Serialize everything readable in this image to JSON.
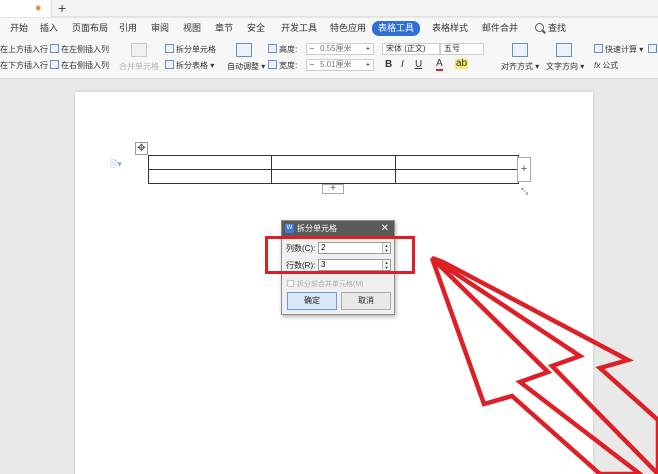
{
  "tabbar": {
    "new_tab": "+"
  },
  "menu": {
    "items": [
      "开始",
      "插入",
      "页面布局",
      "引用",
      "审阅",
      "视图",
      "章节",
      "安全",
      "开发工具",
      "特色应用",
      "表格工具",
      "表格样式",
      "邮件合并"
    ],
    "active": "表格工具",
    "search": "查找"
  },
  "ribbon": {
    "insert_above": "在上方插入行",
    "insert_left": "在左侧插入列",
    "insert_below": "在下方插入行",
    "insert_right": "在右侧插入列",
    "merge_cells": "合并单元格",
    "split_cells": "拆分单元格",
    "split_table": "拆分表格",
    "auto_fit": "自动调整",
    "height_label": "高度:",
    "height_value": "0.55厘米",
    "width_label": "宽度:",
    "width_value": "5.01厘米",
    "font_name": "宋体 (正文)",
    "font_size": "五号",
    "bold": "B",
    "italic": "I",
    "underline": "U",
    "font_color": "A",
    "align": "对齐方式",
    "text_direction": "文字方向",
    "quick_calc": "快速计算",
    "formula": "公式"
  },
  "table": {
    "rows": 2,
    "cols": 3
  },
  "dialog": {
    "title": "拆分单元格",
    "close": "✕",
    "cols_label": "列数(C):",
    "cols_value": "2",
    "rows_label": "行数(R):",
    "rows_value": "3",
    "merge_before_split": "拆分前合并单元格(M)",
    "ok": "确定",
    "cancel": "取消"
  },
  "colors": {
    "annotation_red": "#dd1f26",
    "accent_blue": "#2f6fd6"
  }
}
